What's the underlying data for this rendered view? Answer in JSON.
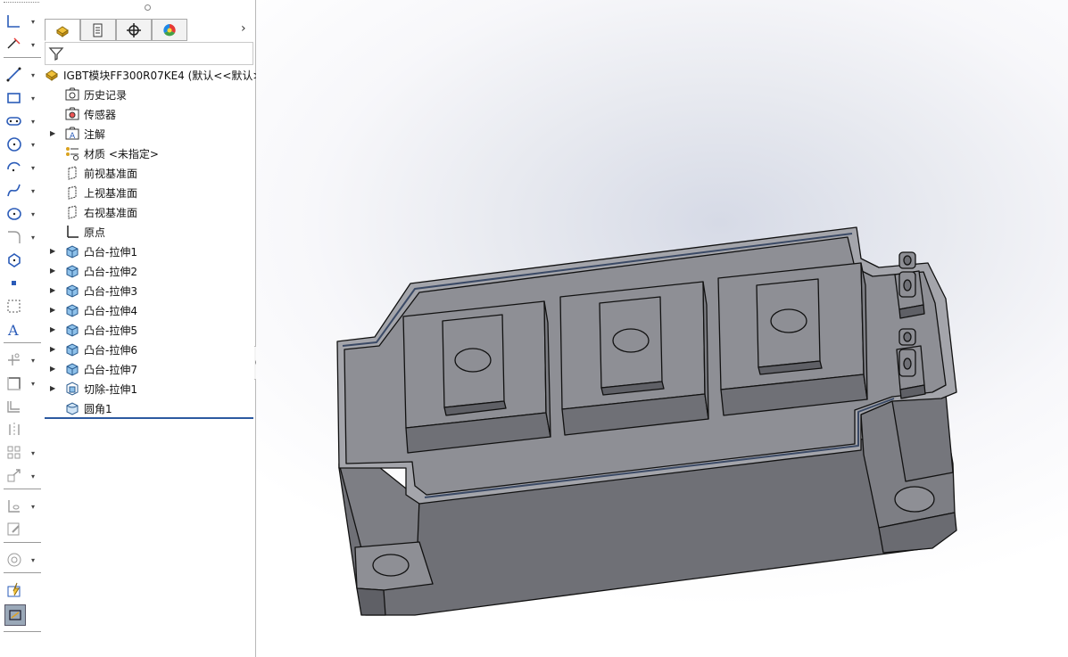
{
  "feature_tree": {
    "root_label": "IGBT模块FF300R07KE4  (默认<<默认>",
    "items": [
      {
        "label": "历史记录",
        "icon": "history-folder-icon",
        "expandable": false
      },
      {
        "label": "传感器",
        "icon": "sensor-folder-icon",
        "expandable": false
      },
      {
        "label": "注解",
        "icon": "annotation-folder-icon",
        "expandable": true
      },
      {
        "label": "材质 <未指定>",
        "icon": "material-icon",
        "expandable": false
      },
      {
        "label": "前视基准面",
        "icon": "plane-icon",
        "expandable": false
      },
      {
        "label": "上视基准面",
        "icon": "plane-icon",
        "expandable": false
      },
      {
        "label": "右视基准面",
        "icon": "plane-icon",
        "expandable": false
      },
      {
        "label": "原点",
        "icon": "origin-icon",
        "expandable": false
      },
      {
        "label": "凸台-拉伸1",
        "icon": "boss-extrude-icon",
        "expandable": true
      },
      {
        "label": "凸台-拉伸2",
        "icon": "boss-extrude-icon",
        "expandable": true
      },
      {
        "label": "凸台-拉伸3",
        "icon": "boss-extrude-icon",
        "expandable": true
      },
      {
        "label": "凸台-拉伸4",
        "icon": "boss-extrude-icon",
        "expandable": true
      },
      {
        "label": "凸台-拉伸5",
        "icon": "boss-extrude-icon",
        "expandable": true
      },
      {
        "label": "凸台-拉伸6",
        "icon": "boss-extrude-icon",
        "expandable": true
      },
      {
        "label": "凸台-拉伸7",
        "icon": "boss-extrude-icon",
        "expandable": true
      },
      {
        "label": "切除-拉伸1",
        "icon": "cut-extrude-icon",
        "expandable": true
      },
      {
        "label": "圆角1",
        "icon": "fillet-icon",
        "expandable": false
      }
    ]
  },
  "feature_manager_tabs": [
    "feature-manager-tab-icon",
    "property-manager-tab-icon",
    "configuration-manager-tab-icon",
    "appearance-manager-tab-icon"
  ],
  "sketch_tools": [
    "corner-rectangle-icon",
    "smart-dimension-icon",
    "line-icon",
    "rectangle-icon",
    "slot-icon",
    "circle-icon",
    "arc-icon",
    "spline-icon",
    "ellipse-icon",
    "fillet-sketch-icon",
    "polygon-icon",
    "point-icon",
    "construction-geometry-icon",
    "text-icon",
    "trim-icon",
    "convert-entities-icon",
    "offset-entities-icon",
    "mirror-entities-icon",
    "linear-pattern-icon",
    "move-entities-icon",
    "display-relations-icon",
    "repair-sketch-icon",
    "quick-snaps-icon",
    "rapid-sketch-icon",
    "instant2d-icon"
  ],
  "colors": {
    "model_face": "#8e8f95",
    "model_face_dark": "#6f7076",
    "model_face_light": "#a4a5ab",
    "edge": "#111111",
    "tree_selection_line": "#2c5aa0",
    "viewport_bg": "#e8eaf0"
  }
}
